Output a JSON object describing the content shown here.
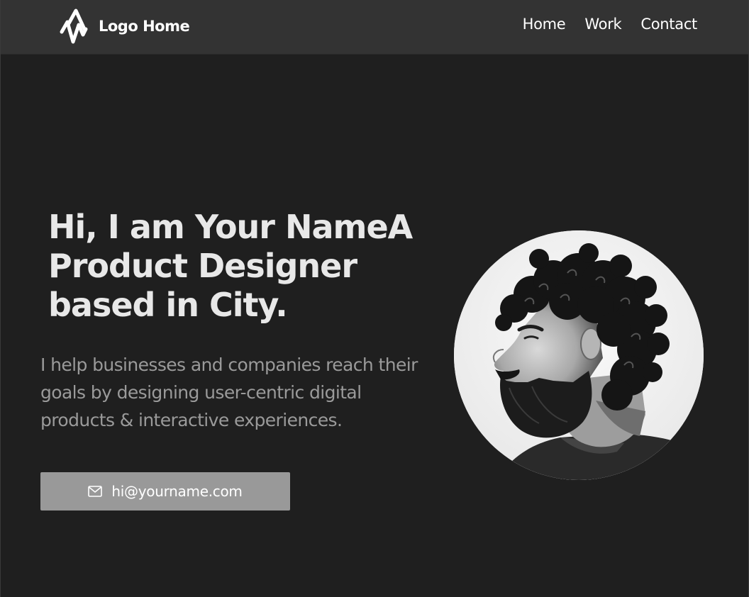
{
  "header": {
    "logo_text": "Logo Home",
    "nav": [
      {
        "label": "Home"
      },
      {
        "label": "Work"
      },
      {
        "label": "Contact"
      }
    ]
  },
  "hero": {
    "title_lines": [
      "Hi, I am Your NameA",
      "Product Designer",
      "based in City."
    ],
    "description_lines": [
      "I help businesses and companies reach their",
      "goals by designing user-centric digital",
      "products & interactive experiences."
    ],
    "email_button": {
      "icon": "mail-icon",
      "label": "hi@yourname.com"
    },
    "portrait": {
      "description_icon": "portrait-photo"
    }
  },
  "colors": {
    "background": "#1f1f1f",
    "header": "#333333",
    "title": "#e8e8e8",
    "description": "#9a9a9a",
    "button": "#999999"
  }
}
